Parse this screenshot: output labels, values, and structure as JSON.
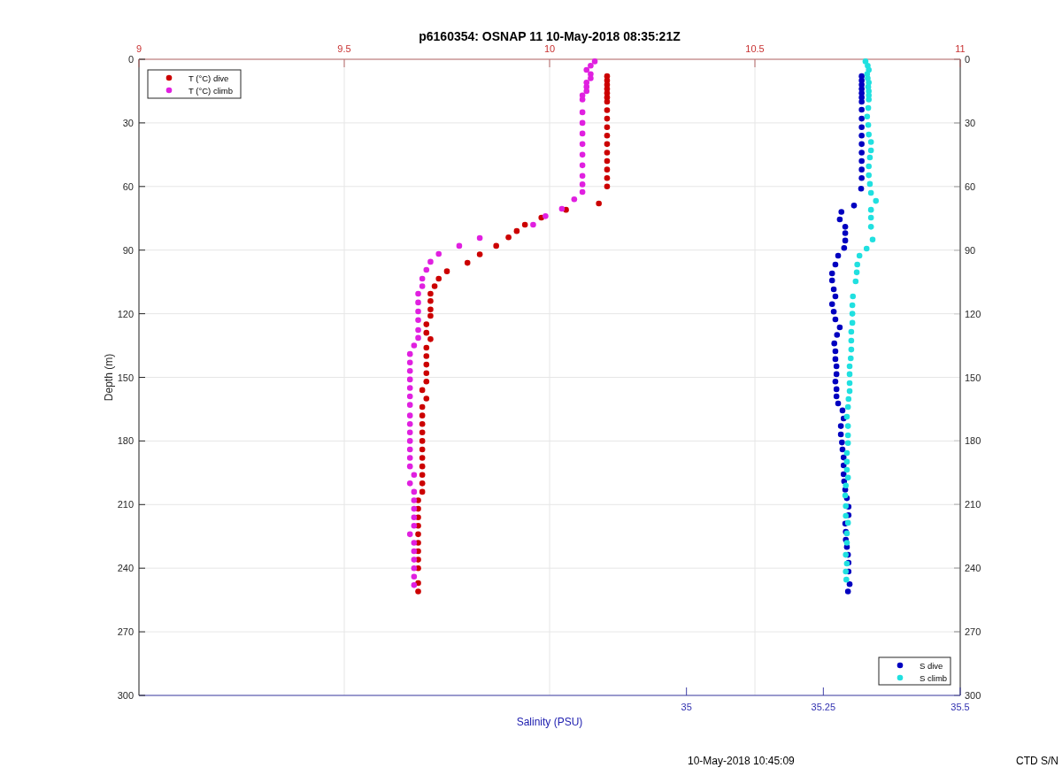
{
  "figure": {
    "chart_data": {
      "type": "scatter",
      "title": "p6160354: OSNAP 11 10-May-2018 08:35:21Z",
      "xlabel": "Salinity (PSU)",
      "ylabel": "Depth (m)",
      "xlim": [
        34,
        35.5
      ],
      "xticks": [
        35,
        35.25,
        35.5
      ],
      "x2lim": [
        9,
        11
      ],
      "x2ticks": [
        9,
        9.5,
        10,
        10.5,
        11
      ],
      "ylim": [
        300,
        0
      ],
      "yticks": [
        0,
        30,
        60,
        90,
        120,
        150,
        180,
        210,
        240,
        270,
        300
      ],
      "grid": true,
      "legend": [
        "upper left",
        "lower right"
      ],
      "y2lim": [
        300,
        0
      ],
      "y2ticks": [
        0,
        30,
        60,
        90,
        120,
        150,
        180,
        210,
        240,
        270,
        300
      ],
      "series": [
        {
          "name": "T (°C) dive",
          "axis": "x2",
          "color": "#cc0000",
          "x": [
            10.14,
            10.14,
            10.14,
            10.14,
            10.14,
            10.14,
            10.14,
            10.14,
            10.14,
            10.14,
            10.14,
            10.14,
            10.14,
            10.14,
            10.14,
            10.14,
            10.14,
            10.12,
            10.04,
            9.98,
            9.94,
            9.92,
            9.9,
            9.87,
            9.83,
            9.8,
            9.75,
            9.73,
            9.72,
            9.71,
            9.71,
            9.71,
            9.71,
            9.7,
            9.7,
            9.71,
            9.7,
            9.7,
            9.7,
            9.7,
            9.7,
            9.69,
            9.7,
            9.69,
            9.69,
            9.69,
            9.69,
            9.69,
            9.69,
            9.69,
            9.69,
            9.69,
            9.69,
            9.69,
            9.68,
            9.68,
            9.68,
            9.68,
            9.68,
            9.68,
            9.68,
            9.68,
            9.68,
            9.68,
            9.68
          ],
          "values": [
            8,
            10,
            12,
            14,
            16,
            18,
            20,
            24,
            28,
            32,
            36,
            40,
            44,
            48,
            52,
            56,
            60,
            68,
            71,
            74.7,
            78,
            81,
            84,
            88,
            92,
            96,
            100,
            103.5,
            107,
            110.6,
            114,
            118,
            121,
            125,
            129,
            132,
            136,
            140,
            144,
            148,
            152,
            156,
            160,
            164,
            168,
            172,
            176,
            180,
            184,
            188,
            192,
            196,
            200,
            204,
            208,
            212,
            216,
            220,
            224,
            228,
            232,
            236,
            240,
            247,
            251
          ]
        },
        {
          "name": "T (°C) climb",
          "axis": "x2",
          "color": "#e020e0",
          "x": [
            10.11,
            10.1,
            10.09,
            10.1,
            10.1,
            10.09,
            10.09,
            10.09,
            10.08,
            10.08,
            10.08,
            10.08,
            10.08,
            10.08,
            10.08,
            10.08,
            10.08,
            10.08,
            10.08,
            10.06,
            10.03,
            9.99,
            9.96,
            9.83,
            9.78,
            9.73,
            9.71,
            9.7,
            9.69,
            9.69,
            9.68,
            9.68,
            9.68,
            9.68,
            9.68,
            9.68,
            9.67,
            9.66,
            9.66,
            9.66,
            9.66,
            9.66,
            9.66,
            9.66,
            9.66,
            9.66,
            9.66,
            9.66,
            9.66,
            9.66,
            9.66,
            9.67,
            9.66,
            9.67,
            9.67,
            9.67,
            9.67,
            9.67,
            9.66,
            9.67,
            9.67,
            9.67,
            9.67,
            9.67,
            9.67
          ],
          "values": [
            1,
            3,
            5,
            7,
            9,
            11,
            13,
            15,
            17,
            19,
            25,
            30,
            35,
            40,
            45,
            50,
            55,
            59,
            62.6,
            66,
            70.5,
            74,
            78,
            84.3,
            88,
            91.8,
            95.5,
            99.3,
            103.5,
            107,
            110.6,
            114.7,
            118.9,
            123,
            127.7,
            131.4,
            135,
            139,
            143,
            147,
            151,
            155,
            159,
            163,
            168,
            172,
            176,
            180,
            184,
            188,
            192,
            196,
            200,
            204,
            208,
            212,
            216,
            220,
            224,
            228,
            232,
            236,
            240,
            244,
            248
          ]
        },
        {
          "name": "S dive",
          "color": "#0000c0",
          "x": [
            35.32,
            35.32,
            35.32,
            35.32,
            35.32,
            35.32,
            35.32,
            35.32,
            35.32,
            35.32,
            35.32,
            35.32,
            35.32,
            35.32,
            35.32,
            35.32,
            35.319,
            35.306,
            35.283,
            35.28,
            35.29,
            35.29,
            35.29,
            35.288,
            35.277,
            35.272,
            35.266,
            35.266,
            35.269,
            35.272,
            35.266,
            35.269,
            35.272,
            35.28,
            35.275,
            35.27,
            35.272,
            35.272,
            35.274,
            35.274,
            35.272,
            35.274,
            35.274,
            35.277,
            35.285,
            35.287,
            35.282,
            35.282,
            35.284,
            35.285,
            35.287,
            35.287,
            35.287,
            35.288,
            35.29,
            35.293,
            35.296,
            35.296,
            35.29,
            35.291,
            35.291,
            35.293,
            35.295,
            35.296,
            35.296,
            35.298,
            35.295
          ],
          "values": [
            8,
            10,
            12,
            14,
            16,
            18,
            20,
            23.8,
            28,
            32,
            36,
            40,
            44,
            48,
            52,
            56,
            61,
            69,
            72,
            75.5,
            79,
            82,
            85.5,
            89,
            92.6,
            96.8,
            101,
            104.3,
            108.5,
            111.8,
            115.5,
            119,
            122.7,
            126.4,
            130,
            134,
            137.7,
            141.4,
            144.8,
            148.5,
            152,
            155.6,
            159,
            162.3,
            165.6,
            169.4,
            173,
            176.9,
            180.7,
            184,
            187.8,
            191.5,
            195.7,
            199,
            203,
            207,
            211,
            215,
            219,
            222.8,
            226.6,
            230,
            233.7,
            237.4,
            241.6,
            247.5,
            251
          ]
        },
        {
          "name": "S climb",
          "color": "#20e0e0",
          "x": [
            35.327,
            35.331,
            35.333,
            35.33,
            35.331,
            35.333,
            35.332,
            35.333,
            35.333,
            35.333,
            35.332,
            35.33,
            35.332,
            35.333,
            35.337,
            35.337,
            35.335,
            35.333,
            35.333,
            35.335,
            35.337,
            35.346,
            35.337,
            35.337,
            35.337,
            35.34,
            35.329,
            35.316,
            35.312,
            35.311,
            35.309,
            35.304,
            35.303,
            35.303,
            35.303,
            35.301,
            35.301,
            35.301,
            35.3,
            35.298,
            35.298,
            35.298,
            35.298,
            35.296,
            35.295,
            35.293,
            35.295,
            35.295,
            35.295,
            35.293,
            35.293,
            35.293,
            35.295,
            35.291,
            35.29,
            35.291,
            35.291,
            35.295,
            35.293,
            35.293,
            35.291,
            35.293,
            35.291,
            35.292
          ],
          "values": [
            1,
            3,
            5,
            7,
            9,
            11,
            13,
            15,
            17,
            19,
            23,
            27,
            31,
            35.5,
            39,
            43,
            46.3,
            50.5,
            54.7,
            58.8,
            63,
            66.8,
            71,
            74.7,
            79,
            85,
            89.3,
            92.6,
            96.8,
            100.5,
            104.7,
            111.8,
            116,
            120,
            124.3,
            128.5,
            132.7,
            136.9,
            141,
            144.8,
            148.5,
            152.7,
            156.5,
            160.2,
            164,
            168.6,
            173,
            177.3,
            181,
            185.7,
            189.8,
            193.6,
            197.3,
            201,
            205.7,
            210.7,
            215.3,
            218.6,
            223.6,
            228,
            233.7,
            237.8,
            241.6,
            245.4
          ]
        }
      ]
    }
  },
  "footer": {
    "timestamp": "10-May-2018 10:45:09",
    "label": "CTD S/N"
  }
}
